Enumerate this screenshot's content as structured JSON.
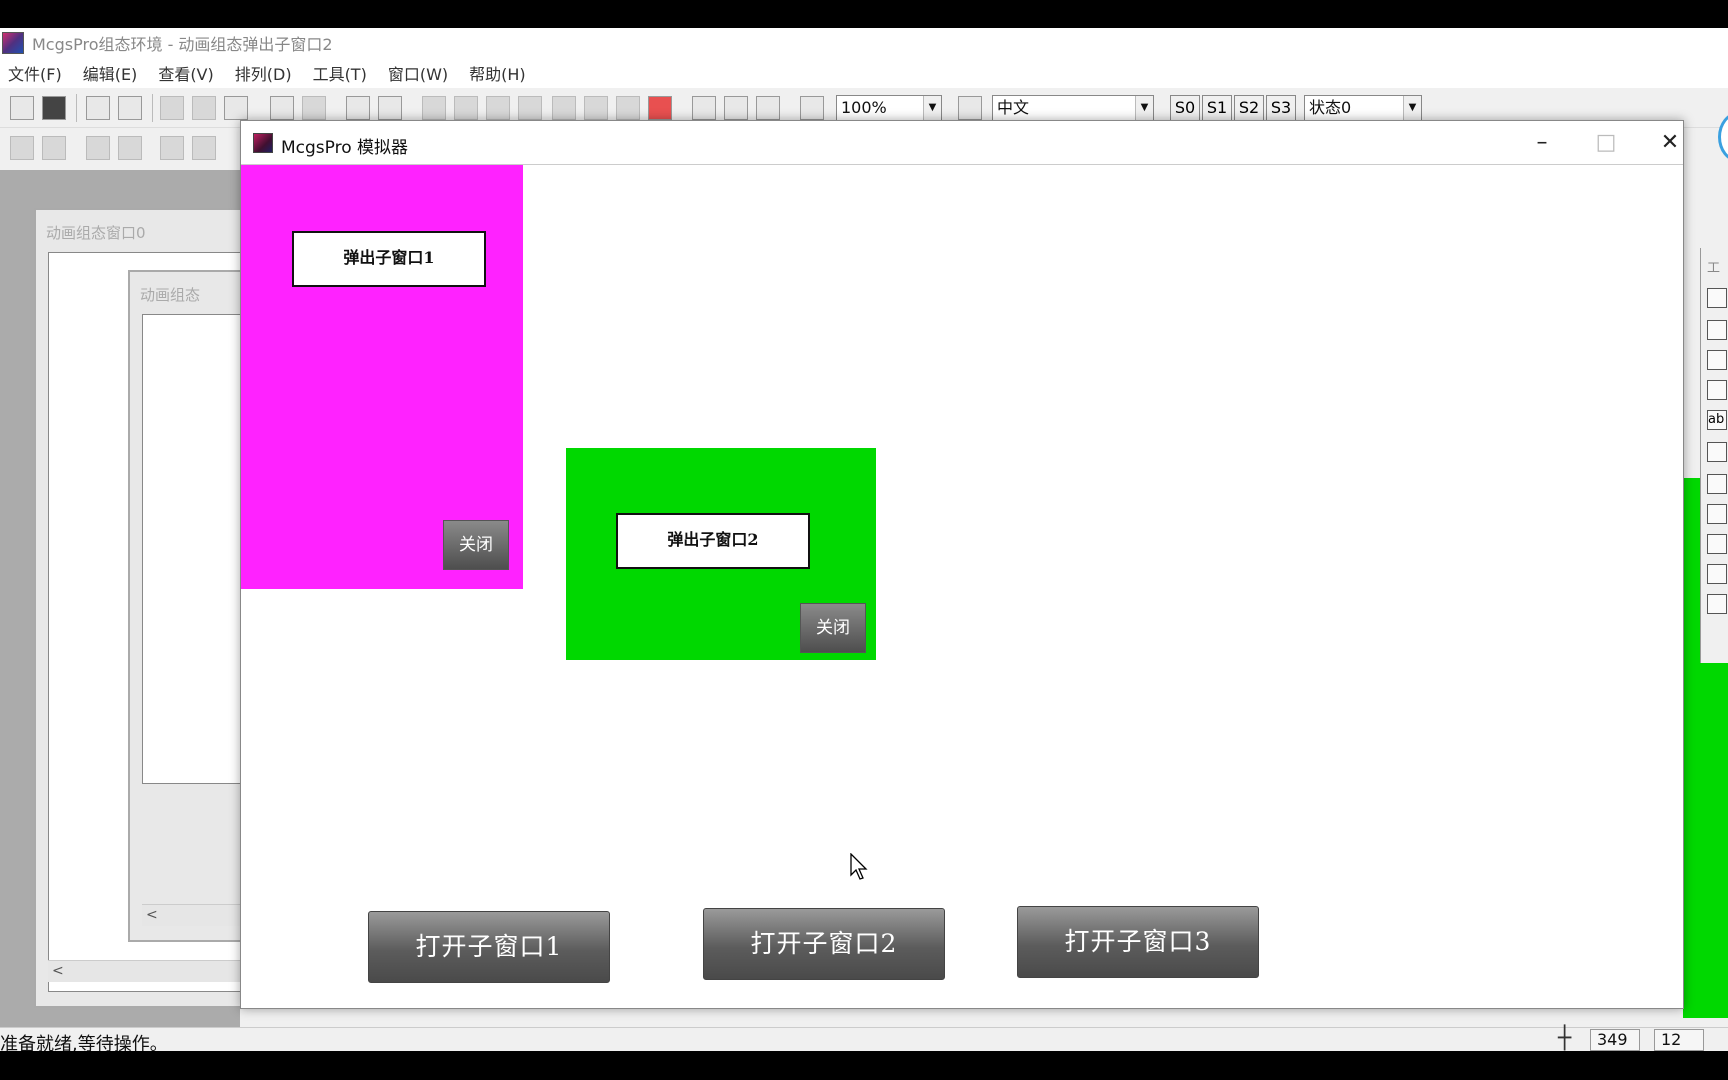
{
  "app": {
    "title": "McgsPro组态环境 - 动画组态弹出子窗口2",
    "menu": [
      "文件(F)",
      "编辑(E)",
      "查看(V)",
      "排列(D)",
      "工具(T)",
      "窗口(W)",
      "帮助(H)"
    ]
  },
  "toolbar": {
    "zoom": "100%",
    "language": "中文",
    "states": [
      "S0",
      "S1",
      "S2",
      "S3"
    ],
    "state_select": "状态0"
  },
  "background_windows": {
    "win0_title": "动画组态窗口0",
    "win1_title": "动画组态"
  },
  "simulator": {
    "title": "McgsPro 模拟器",
    "minimize": "–",
    "maximize": "□",
    "close": "✕",
    "popup1": {
      "label": "弹出子窗口1",
      "close_label": "关闭",
      "color": "#ff22ff"
    },
    "popup2": {
      "label": "弹出子窗口2",
      "close_label": "关闭",
      "color": "#00d800"
    },
    "open_buttons": [
      "打开子窗口1",
      "打开子窗口2",
      "打开子窗口3"
    ]
  },
  "toolbox": {
    "title": "工",
    "text_tool": "ab"
  },
  "statusbar": {
    "text": "准备就绪,等待操作。",
    "x": "349",
    "y": "12"
  }
}
